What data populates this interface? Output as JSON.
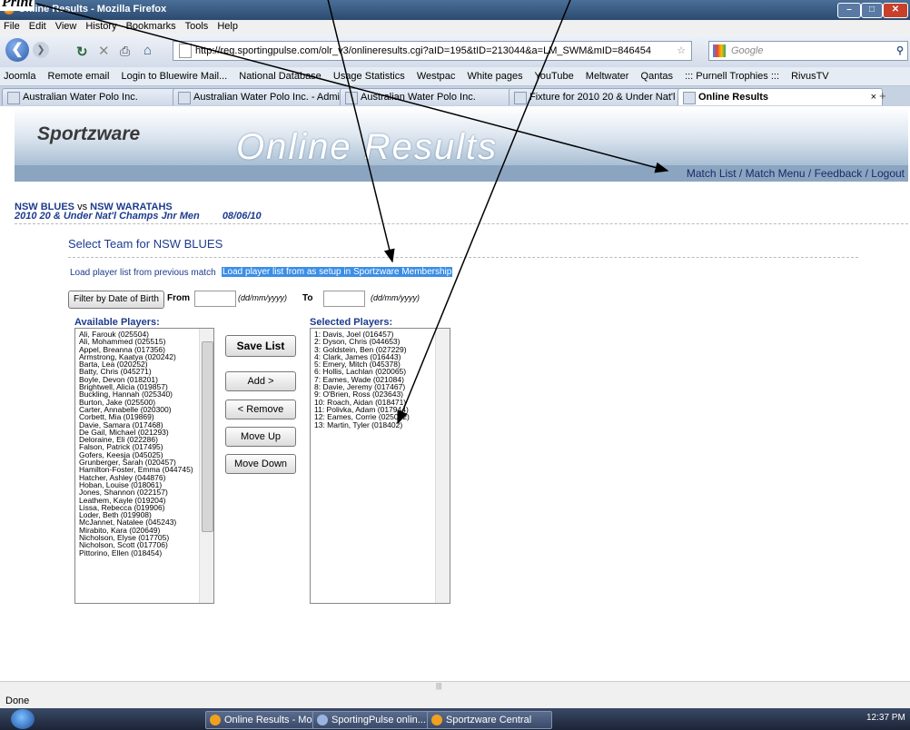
{
  "corner_text": "Print",
  "window": {
    "title": "Online Results - Mozilla Firefox"
  },
  "menu": [
    "File",
    "Edit",
    "View",
    "History",
    "Bookmarks",
    "Tools",
    "Help"
  ],
  "url": "http://reg.sportingpulse.com/olr_v3/onlineresults.cgi?aID=195&tID=213044&a=LM_SWM&mID=846454",
  "search_placeholder": "Google",
  "bookmarks": [
    "Joomla",
    "Remote email",
    "Login to Bluewire Mail...",
    "National Database",
    "Usage Statistics",
    "Westpac",
    "White pages",
    "YouTube",
    "Meltwater",
    "Qantas",
    "::: Purnell Trophies :::",
    "RivusTV"
  ],
  "tabs": [
    {
      "label": "Australian Water Polo Inc."
    },
    {
      "label": "Australian Water Polo Inc. - Admin..."
    },
    {
      "label": "Australian Water Polo Inc."
    },
    {
      "label": "Fixture for 2010 20 & Under Nat'l C..."
    },
    {
      "label": "Online Results"
    }
  ],
  "banner": {
    "logo": "Sportzware",
    "heading": "Online Results"
  },
  "top_links": "Match List / Match Menu / Feedback / Logout",
  "match": {
    "home": "NSW BLUES",
    "vs": "vs",
    "away": "NSW WARATAHS",
    "competition": "2010 20 & Under Nat'l Champs Jnr Men",
    "date": "08/06/10"
  },
  "select_title": "Select Team for NSW BLUES",
  "load_prev": "Load player list from previous match",
  "load_membership": "Load player list from as setup in Sportzware Membership",
  "filter": {
    "button": "Filter by Date of Birth",
    "from_label": "From",
    "to_label": "To",
    "date_hint": "(dd/mm/yyyy)"
  },
  "available_title": "Available Players:",
  "selected_title": "Selected Players:",
  "available_players": [
    "Ali, Farouk (025504)",
    "Ali, Mohammed (025515)",
    "Appel, Breanna (017356)",
    "Armstrong, Kaatya (020242)",
    "Barta, Lea (020252)",
    "Batty, Chris (045271)",
    "Boyle, Devon (018201)",
    "Brightwell, Alicia (019857)",
    "Buckling, Hannah (025340)",
    "Burton, Jake (025500)",
    "Carter, Annabelle (020300)",
    "Corbett, Mia (019869)",
    "Davie, Samara (017468)",
    "De Gail, Michael (021293)",
    "Deloraine, Eli (022286)",
    "Falson, Patrick (017495)",
    "Gofers, Keesja (045025)",
    "Grunberger, Sarah (020457)",
    "Hamilton-Foster, Emma (044745)",
    "Hatcher, Ashley (044876)",
    "Hoban, Louise (018061)",
    "Jones, Shannon (022157)",
    "Leathem, Kayle (019204)",
    "Lissa, Rebecca (019906)",
    "Loder, Beth (019908)",
    "McJannet, Natalee (045243)",
    "Mirabito, Kara (020649)",
    "Nicholson, Elyse (017705)",
    "Nicholson, Scott (017706)",
    "Pittorino, Ellen (018454)"
  ],
  "selected_players": [
    "1: Davis, Joel (016457)",
    "2: Dyson, Chris (044653)",
    "3: Goldstein, Ben (027229)",
    "4: Clark, James (016443)",
    "5: Emery, Mitch (045378)",
    "6: Hollis, Lachlan (020065)",
    "7: Eames, Wade (021084)",
    "8: Davie, Jeremy (017467)",
    "9: O'Brien, Ross (023643)",
    "10: Roach, Aidan (018471)",
    "11: Polivka, Adam (017944)",
    "12: Eames, Corrie (025082)",
    "13: Martin, Tyler (018402)"
  ],
  "buttons": {
    "save": "Save List",
    "add": "Add >",
    "remove": "< Remove",
    "up": "Move Up",
    "down": "Move Down"
  },
  "status": "Done",
  "taskbar": {
    "items": [
      "Online Results - Mo...",
      "SportingPulse onlin...",
      "Sportzware Central"
    ],
    "clock": "12:37 PM"
  },
  "colors": {
    "link_blue": "#1d3b8e",
    "highlight": "#3a8ee6",
    "banner_bar": "#8ba5c0"
  }
}
